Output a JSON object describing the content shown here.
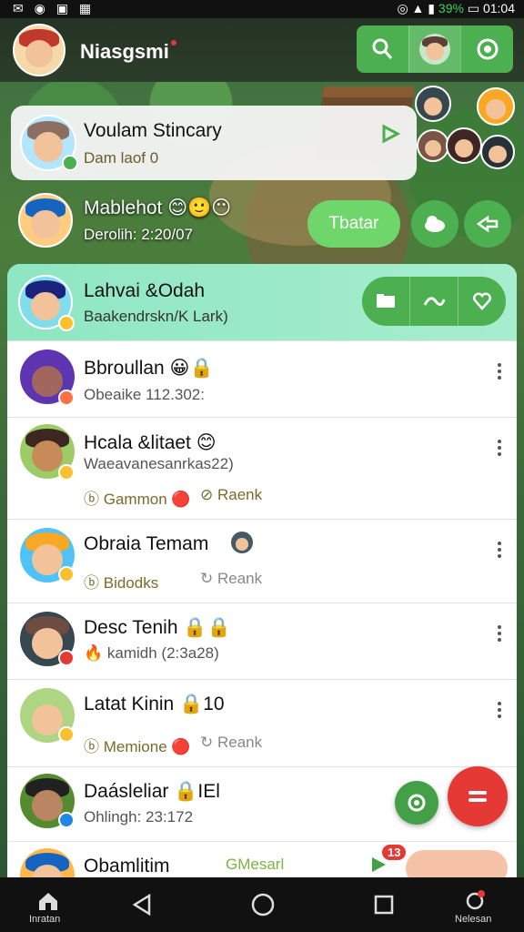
{
  "status_bar": {
    "left_icons": "✉ ◉ ▣ ▦",
    "battery_pct": "39%",
    "time": "01:04"
  },
  "app_bar": {
    "title": "Niasgsmi"
  },
  "pinned": [
    {
      "name": "Voulam Stincary",
      "sub": "Dam laof 0"
    },
    {
      "name": "Mablehot 😊🙂😶",
      "sub": "Derolih: 2:20/07",
      "action_label": "Tbatar"
    }
  ],
  "active_chat": {
    "name": "Lahvai &Odah",
    "sub": "Baakendrskn/K Lark)"
  },
  "chats": [
    {
      "name": "Bbroullan 😀🔒",
      "sub": "Obeaike 112.302:"
    },
    {
      "name": "Hcala &litaet 😊",
      "sub": "Waeavanesanrkas22)",
      "chip1": "Gammon",
      "chip2": "Raenk"
    },
    {
      "name": "Obraia Temam",
      "chip1": "Bidodks",
      "chip2": "Reank"
    },
    {
      "name": "Desc Tenih 🔒🔒",
      "sub": "kamidh (2:3a28)"
    },
    {
      "name": "Latat Kinin 🔒10",
      "chip1": "Memione",
      "chip2": "Reank"
    },
    {
      "name": "Daásleliar 🔒IEl",
      "sub": "Ohlingh: 23:172"
    },
    {
      "name": "Obamlitim",
      "sub": "GMesarl",
      "badge": "13"
    }
  ],
  "nav": {
    "home": "Inratan",
    "profile": "Nelesan"
  },
  "colors": {
    "accent": "#4caf50",
    "fab": "#e53935",
    "active_row": "#8ee6c2"
  }
}
